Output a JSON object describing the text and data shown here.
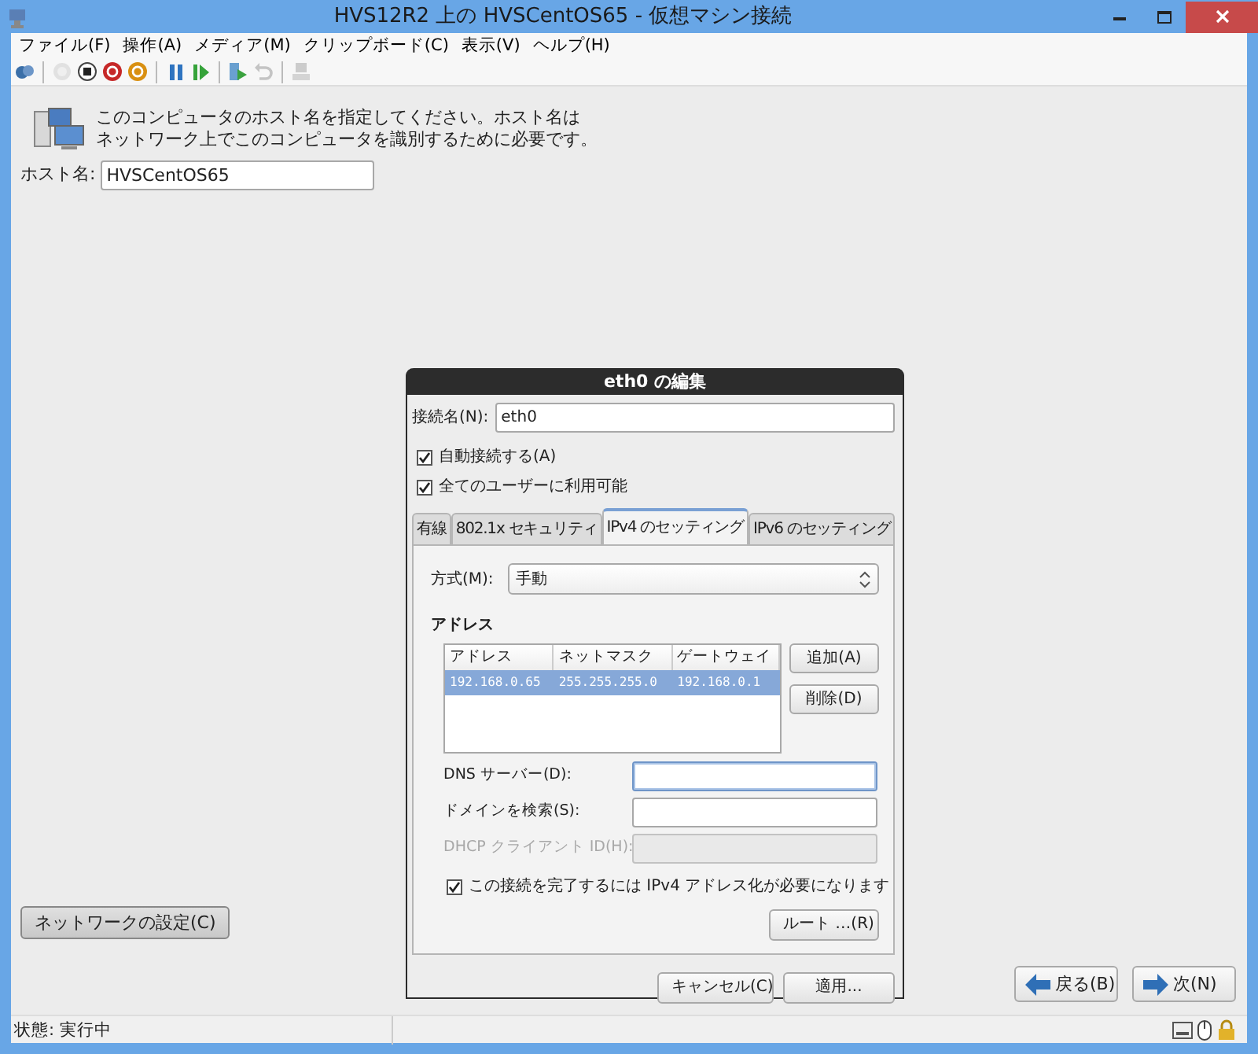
{
  "window": {
    "title": "HVS12R2 上の HVSCentOS65  - 仮想マシン接続"
  },
  "menu": [
    "ファイル(F)",
    "操作(A)",
    "メディア(M)",
    "クリップボード(C)",
    "表示(V)",
    "ヘルプ(H)"
  ],
  "toolbar": [
    {
      "kind": "ctrlaltdel",
      "disabled": false
    },
    {
      "kind": "sep"
    },
    {
      "kind": "start",
      "disabled": true
    },
    {
      "kind": "turnoff",
      "disabled": false
    },
    {
      "kind": "shutdown",
      "disabled": false
    },
    {
      "kind": "save",
      "disabled": false
    },
    {
      "kind": "sep"
    },
    {
      "kind": "pause",
      "disabled": false
    },
    {
      "kind": "resume",
      "disabled": false
    },
    {
      "kind": "sep"
    },
    {
      "kind": "checkpoint",
      "disabled": false
    },
    {
      "kind": "revert",
      "disabled": true
    },
    {
      "kind": "sep"
    },
    {
      "kind": "session",
      "disabled": true
    }
  ],
  "installer": {
    "prompt": [
      "このコンピュータのホスト名を指定してください。ホスト名は",
      "ネットワーク上でこのコンピュータを識別するために必要です。"
    ],
    "hostname_label": "ホスト名:",
    "hostname_value": "HVSCentOS65",
    "network_button": "ネットワークの設定(C)"
  },
  "dialog": {
    "title": "eth0 の編集",
    "connection_label": "接続名(N):",
    "connection_value": "eth0",
    "checkboxes": [
      {
        "label": "自動接続する(A)",
        "checked": true
      },
      {
        "label": "全てのユーザーに利用可能",
        "checked": true
      }
    ],
    "tabs": [
      {
        "label": "有線",
        "selected": false
      },
      {
        "label": "802.1x セキュリティ",
        "selected": false
      },
      {
        "label": "IPv4 のセッティング",
        "selected": true
      },
      {
        "label": "IPv6 のセッティング",
        "selected": false
      }
    ],
    "method_label": "方式(M):",
    "method_value": "手動",
    "section": "アドレス",
    "table": {
      "columns": [
        "アドレス",
        "ネットマスク",
        "ゲートウェイ"
      ],
      "rows": [
        {
          "cells": [
            "192.168.0.65",
            "255.255.255.0",
            "192.168.0.1"
          ],
          "selected": true
        }
      ]
    },
    "add_button": "追加(A)",
    "delete_button": "削除(D)",
    "fields": [
      {
        "label": "DNS サーバー(D):",
        "disabled": false,
        "focused": true
      },
      {
        "label": "ドメインを検索(S):",
        "disabled": false,
        "focused": false
      },
      {
        "label": "DHCP クライアント ID(H):",
        "disabled": true,
        "focused": false
      }
    ],
    "require": {
      "label": "この接続を完了するには IPv4 アドレス化が必要になります",
      "checked": true
    },
    "routes_button": "ルート …(R)",
    "cancel_button": "キャンセル(C)",
    "apply_button": "適用..."
  },
  "nav": {
    "back": "戻る(B)",
    "next": "次(N)"
  },
  "status_bar": {
    "text": "状態: 実行中"
  }
}
